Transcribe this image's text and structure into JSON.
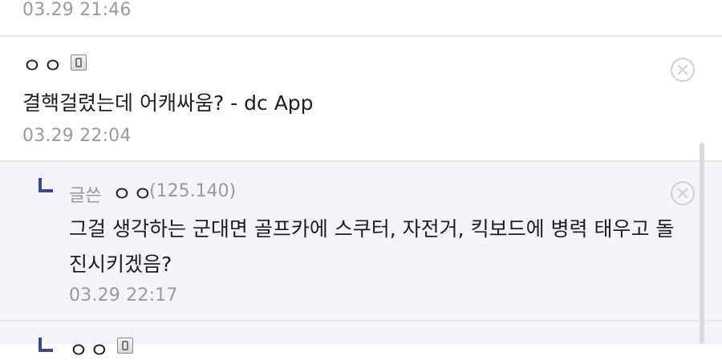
{
  "comments": [
    {
      "time": "03.29 21:46"
    },
    {
      "nick": "ㅇㅇ",
      "icon": "mobile-icon",
      "text": "결핵걸렸는데 어캐싸움? - dc App",
      "time": "03.29 22:04"
    }
  ],
  "reply": {
    "label": "글쓴",
    "nick": "ㅇㅇ",
    "ip": "(125.140)",
    "text_line1": "그걸 생각하는 군대면 골프카에 스쿠터, 자전거, 킥보드에 병력 태우고 돌",
    "text_line2": "진시키겠음?",
    "time": "03.29 22:17"
  },
  "next_reply": {
    "nick": "ㅇㅇ",
    "icon": "mobile-icon"
  },
  "colors": {
    "reply_bg": "#f3f3f8",
    "reply_arrow": "#3c4a8a",
    "muted": "#9a9a9a"
  }
}
